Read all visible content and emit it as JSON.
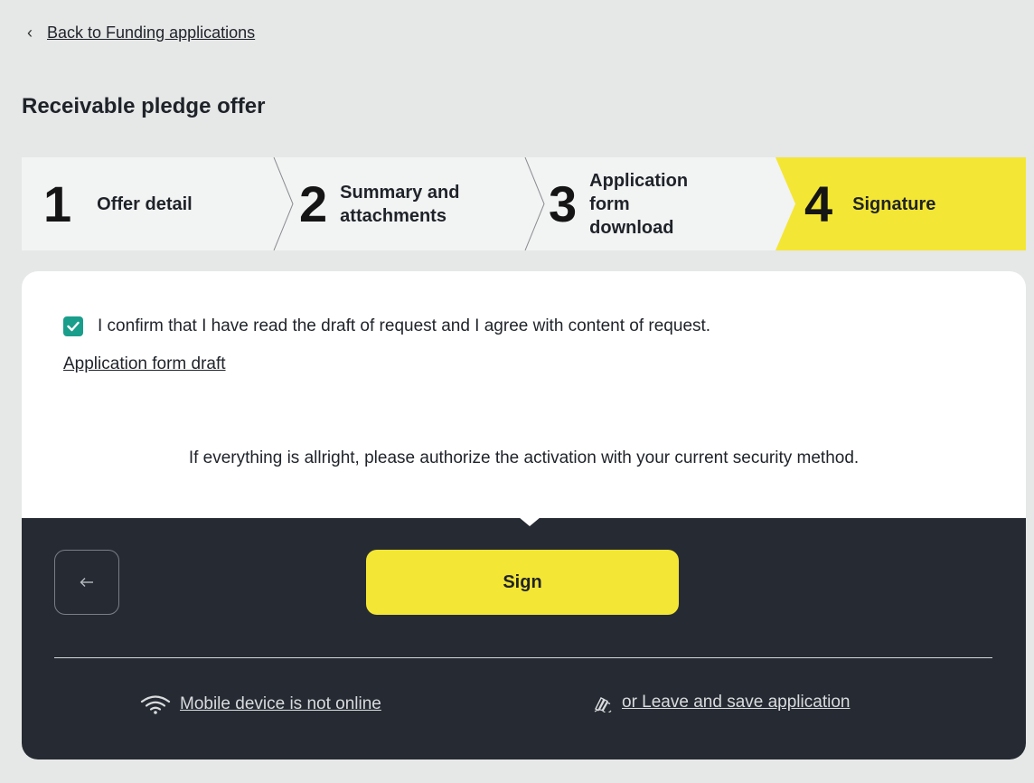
{
  "nav": {
    "back_label": "Back to Funding applications"
  },
  "page": {
    "title": "Receivable pledge offer"
  },
  "stepper": {
    "steps": [
      {
        "number": "1",
        "label": "Offer detail"
      },
      {
        "number": "2",
        "label": "Summary and attachments"
      },
      {
        "number": "3",
        "label": "Application form download"
      },
      {
        "number": "4",
        "label": "Signature"
      }
    ],
    "active_step": 4,
    "active_color": "#f4e634"
  },
  "confirmation": {
    "checked": true,
    "text": "I confirm that I have read the draft of request and I agree with content of request.",
    "draft_link": "Application form draft"
  },
  "info": {
    "text": "If everything is allright, please authorize the activation with your current security method."
  },
  "actions": {
    "back_icon": "arrow-left-icon",
    "sign_label": "Sign",
    "mobile_status": "Mobile device is not online",
    "leave_save": "or Leave and save application"
  },
  "colors": {
    "accent": "#f4e634",
    "checkbox": "#1a9e8c",
    "dark_panel": "#262b33"
  }
}
